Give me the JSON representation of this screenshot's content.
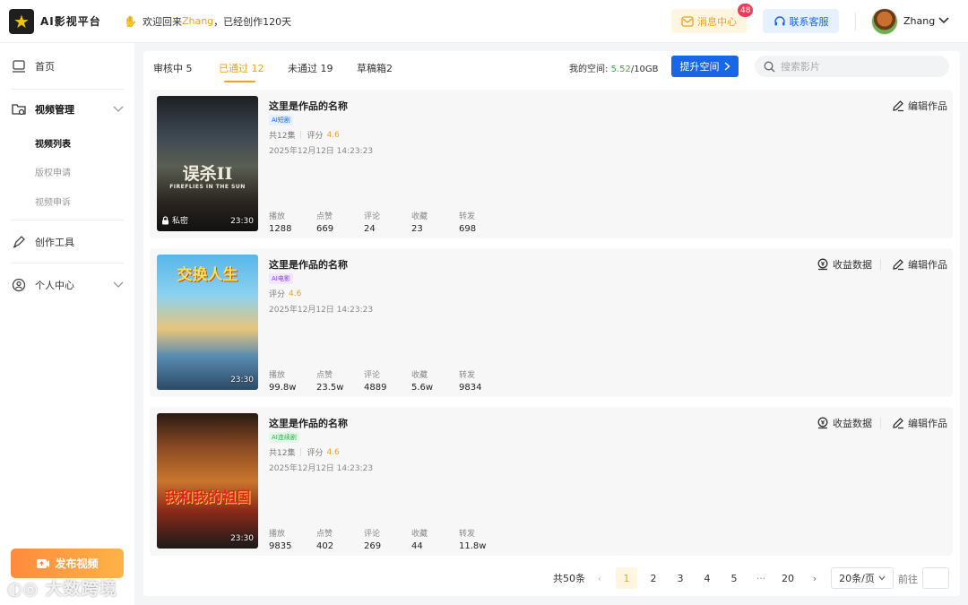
{
  "app": {
    "logo_text": "AI影视平台"
  },
  "header": {
    "welcome_prefix": "欢迎回来",
    "username": "Zhang",
    "welcome_suffix": "，已经创作120天",
    "messages_label": "消息中心",
    "messages_badge": "48",
    "support_label": "联系客服",
    "user_name": "Zhang"
  },
  "sidebar": {
    "home": "首页",
    "video_mgmt": "视频管理",
    "video_list": "视频列表",
    "copyright_apply": "版权申请",
    "video_appeal": "视频申诉",
    "creation_tools": "创作工具",
    "personal_center": "个人中心",
    "publish_button": "发布视频",
    "watermark": "大数跨境"
  },
  "tabs": [
    {
      "label": "审核中 5"
    },
    {
      "label": "已通过 12"
    },
    {
      "label": "未通过 19"
    },
    {
      "label": "草稿箱2"
    }
  ],
  "space": {
    "label": "我的空间:",
    "used": "5.52",
    "total": "/10GB",
    "upgrade_label": "提升空间"
  },
  "search": {
    "placeholder": "搜索影片"
  },
  "stat_labels": {
    "plays": "播放",
    "likes": "点赞",
    "comments": "评论",
    "favorites": "收藏",
    "shares": "转发"
  },
  "actions": {
    "edit": "编辑作品",
    "revenue": "收益数据"
  },
  "works": [
    {
      "title": "这里是作品的名称",
      "tag": "AI短剧",
      "episodes": "共12集",
      "score_label": "评分",
      "score": "4.6",
      "date": "2025年12月12日 14:23:23",
      "duration": "23:30",
      "private_label": "私密",
      "poster_text": "误杀II",
      "poster_sub": "FIREFLIES IN THE SUN",
      "stats": {
        "plays": "1288",
        "likes": "669",
        "comments": "24",
        "favorites": "23",
        "shares": "698"
      }
    },
    {
      "title": "这里是作品的名称",
      "tag": "AI电影",
      "score_label": "评分",
      "score": "4.6",
      "date": "2025年12月12日 14:23:23",
      "duration": "23:30",
      "poster_text": "交换人生",
      "stats": {
        "plays": "99.8w",
        "likes": "23.5w",
        "comments": "4889",
        "favorites": "5.6w",
        "shares": "9834"
      }
    },
    {
      "title": "这里是作品的名称",
      "tag": "AI连续剧",
      "episodes": "共12集",
      "score_label": "评分",
      "score": "4.6",
      "date": "2025年12月12日 14:23:23",
      "duration": "23:30",
      "poster_text": "我和我的祖国",
      "stats": {
        "plays": "9835",
        "likes": "402",
        "comments": "269",
        "favorites": "44",
        "shares": "11.8w"
      }
    }
  ],
  "pagination": {
    "total": "共50条",
    "pages": [
      "1",
      "2",
      "3",
      "4",
      "5",
      "···",
      "20"
    ],
    "prev": "‹",
    "next": "›",
    "page_size": "20条/页",
    "goto_label": "前往"
  },
  "colors": {
    "accent": "#f0a020",
    "primary": "#1867e8",
    "green": "#2cb34a",
    "badge": "#f33a5a"
  }
}
